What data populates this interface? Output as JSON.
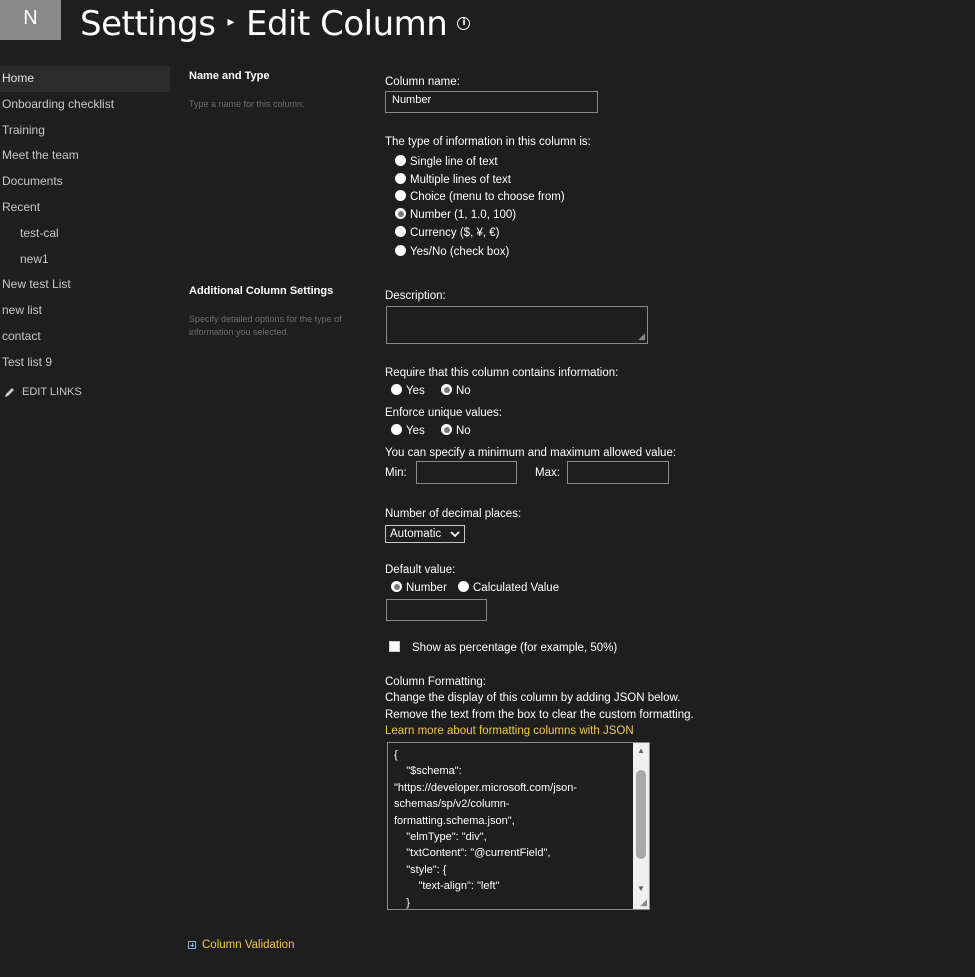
{
  "header": {
    "logo_letter": "N",
    "breadcrumb_root": "Settings",
    "separator": "▸",
    "page_title": "Edit Column",
    "info_icon": "ⓘ"
  },
  "quicklaunch": {
    "items": [
      {
        "label": "Home"
      },
      {
        "label": "Onboarding checklist"
      },
      {
        "label": "Training"
      },
      {
        "label": "Meet the team"
      },
      {
        "label": "Documents"
      },
      {
        "label": "Recent"
      },
      {
        "label": "test-cal"
      },
      {
        "label": "new1"
      },
      {
        "label": "New test List"
      },
      {
        "label": "new list"
      },
      {
        "label": "contact"
      },
      {
        "label": "Test list 9"
      }
    ],
    "edit_links": "EDIT LINKS"
  },
  "sections": {
    "name_type": {
      "title": "Name and Type",
      "desc": "Type a name for this column."
    },
    "additional": {
      "title": "Additional Column Settings",
      "desc": "Specify detailed options for the type of information you selected."
    }
  },
  "form": {
    "column_name_label": "Column name:",
    "column_name_value": "Number",
    "type_label": "The type of information in this column is:",
    "types": [
      "Single line of text",
      "Multiple lines of text",
      "Choice (menu to choose from)",
      "Number (1, 1.0, 100)",
      "Currency ($, ¥, €)",
      "Yes/No (check box)"
    ],
    "selected_type": "Number (1, 1.0, 100)",
    "description_label": "Description:",
    "require_label": "Require that this column contains information:",
    "require_yes": "Yes",
    "require_no": "No",
    "unique_label": "Enforce unique values:",
    "unique_yes": "Yes",
    "unique_no": "No",
    "minmax_label": "You can specify a minimum and maximum allowed value:",
    "min_label": "Min:",
    "max_label": "Max:",
    "decimal_label": "Number of decimal places:",
    "decimal_value": "Automatic",
    "default_label": "Default value:",
    "default_number": "Number",
    "default_calculated": "Calculated Value",
    "percentage_label": "Show as percentage (for example, 50%)",
    "formatting_title": "Column Formatting:",
    "formatting_line1": "Change the display of this column by adding JSON below.",
    "formatting_line2": "Remove the text from the box to clear the custom formatting.",
    "formatting_link": "Learn more about formatting columns with JSON",
    "json_value": "{\n    \"$schema\":\n\"https://developer.microsoft.com/json-\nschemas/sp/v2/column-\nformatting.schema.json\",\n    \"elmType\": \"div\",\n    \"txtContent\": \"@currentField\",\n    \"style\": {\n        \"text-align\": \"left\"\n    }"
  },
  "column_validation": "Column Validation"
}
